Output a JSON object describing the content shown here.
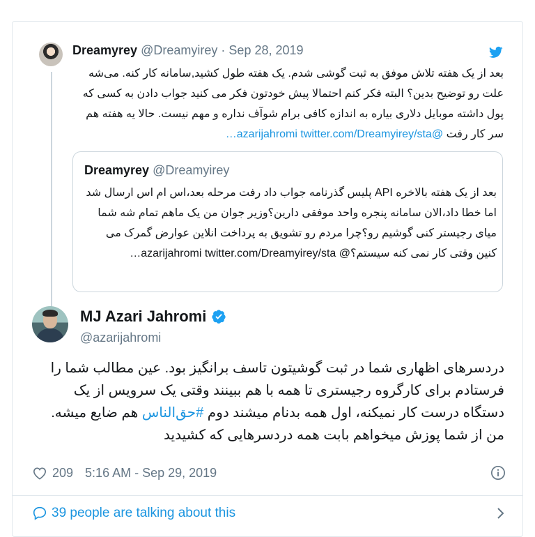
{
  "parent_tweet": {
    "name": "Dreamyrey",
    "handle": "@Dreamyirey",
    "separator": "·",
    "date": "Sep 28, 2019",
    "text": "بعد از یک هفته تلاش موفق به ثبت گوشی شدم. یک هفته طول کشید,سامانه کار کنه. می‌شه علت رو توضیح بدین؟ البته فکر کنم احتمالا پیش خودتون فکر می کنید جواب دادن به کسی که پول داشته موبایل دلاری بیاره به اندازه کافی برام شوآف نداره و مهم نیست. حالا یه هفته هم سر کار رفت",
    "mention": "@azarijahromi",
    "link": "twitter.com/Dreamyirey/sta…"
  },
  "quoted_tweet": {
    "name": "Dreamyrey",
    "handle": "@Dreamyirey",
    "text": "بعد از یک هفته بالاخره API پلیس گذرنامه جواب داد رفت مرحله بعد،اس ام اس ارسال شد اما خطا داد،الان سامانه پنجره واحد موفقی دارین؟وزیر جوان من یک ماهم تمام شه شما میای رجیستر کنی گوشیم رو؟چرا مردم رو تشویق به پرداخت انلاین عوارض گمرک می کنین وقتی کار نمی کنه سیستم؟@ azarijahromi",
    "link": "twitter.com/Dreamyirey/sta…"
  },
  "main_tweet": {
    "name": "MJ Azari Jahromi",
    "handle": "@azarijahromi",
    "text_before": "دردسرهای اظهاری شما در ثبت گوشیتون تاسف برانگیز بود. عین مطالب شما را فرستادم برای کارگروه رجیستری تا همه با هم ببینند وقتی یک سرویس از یک دستگاه درست کار نمیکنه، اول همه بدنام میشند دوم ",
    "hashtag": "#حق‌الناس",
    "text_after": " هم ضایع میشه. من از شما پوزش میخواهم بابت همه دردسرهایی که کشیدید",
    "likes": "209",
    "time": "5:16 AM - Sep 29, 2019"
  },
  "footer": {
    "talking": "39 people are talking about this"
  },
  "icons": {
    "brand": "twitter-bird-icon",
    "verified": "verified-badge-icon",
    "like": "heart-icon",
    "info": "info-icon",
    "reply": "speech-bubble-icon",
    "chevron": "chevron-right-icon"
  },
  "colors": {
    "accent": "#1da1f2",
    "link": "#1b95e0",
    "muted": "#657786"
  }
}
